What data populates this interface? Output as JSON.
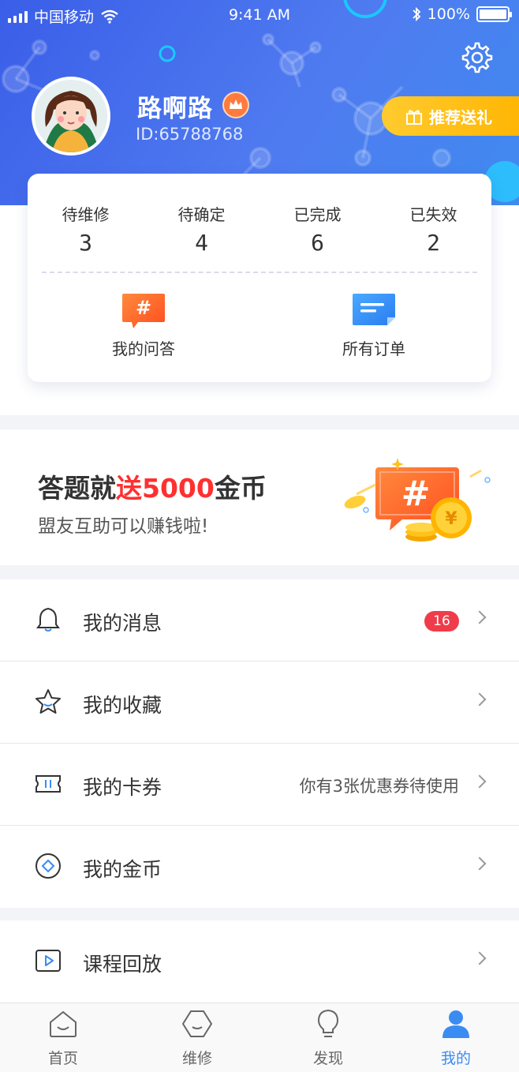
{
  "status_bar": {
    "carrier": "中国移动",
    "time": "9:41 AM",
    "battery": "100%"
  },
  "profile": {
    "name": "路啊路",
    "id": "ID:65788768",
    "gift_button": "推荐送礼"
  },
  "orders": {
    "stats": [
      {
        "label": "待维修",
        "value": "3"
      },
      {
        "label": "待确定",
        "value": "4"
      },
      {
        "label": "已完成",
        "value": "6"
      },
      {
        "label": "已失效",
        "value": "2"
      }
    ],
    "quick_links": [
      {
        "label": "我的问答",
        "icon": "qa-hash-icon"
      },
      {
        "label": "所有订单",
        "icon": "orders-list-icon"
      }
    ]
  },
  "banner": {
    "title_prefix": "答题就",
    "title_highlight": "送5000",
    "title_suffix": "金币",
    "subtitle": "盟友互助可以赚钱啦!"
  },
  "menu": [
    {
      "label": "我的消息",
      "icon": "bell-icon",
      "badge": "16",
      "hint": ""
    },
    {
      "label": "我的收藏",
      "icon": "star-icon",
      "badge": "",
      "hint": ""
    },
    {
      "label": "我的卡券",
      "icon": "ticket-icon",
      "badge": "",
      "hint": "你有3张优惠券待使用"
    },
    {
      "label": "我的金币",
      "icon": "coin-icon",
      "badge": "",
      "hint": ""
    }
  ],
  "menu2": [
    {
      "label": "课程回放",
      "icon": "play-icon"
    }
  ],
  "tabs": [
    {
      "label": "首页",
      "icon": "home-icon",
      "active": false
    },
    {
      "label": "维修",
      "icon": "repair-icon",
      "active": false
    },
    {
      "label": "发现",
      "icon": "bulb-icon",
      "active": false
    },
    {
      "label": "我的",
      "icon": "user-icon",
      "active": true
    }
  ],
  "colors": {
    "primary": "#4a6ef0",
    "accent_gold": "#ffb400",
    "badge_red": "#f03c4a",
    "highlight_red": "#ff3030",
    "tab_active": "#3a8cf2"
  }
}
